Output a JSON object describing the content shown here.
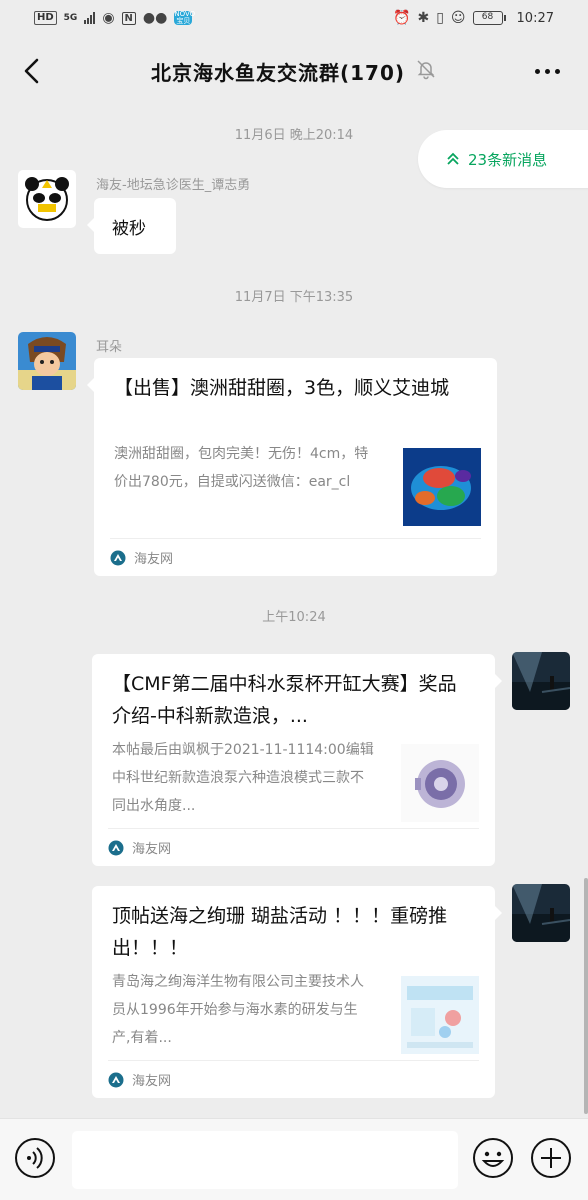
{
  "status_bar": {
    "hd": "HD",
    "network": "5G",
    "nfc": "N",
    "app_badge": "NOVO 宝贝",
    "battery": "68",
    "time": "10:27"
  },
  "header": {
    "title": "北京海水鱼友交流群(170)"
  },
  "new_messages": {
    "label": "23条新消息"
  },
  "messages": [
    {
      "timestamp": "11月6日 晚上20:14",
      "sender": "海友-地坛急诊医生_谭志勇",
      "text": "被秒"
    },
    {
      "timestamp": "11月7日 下午13:35",
      "sender": "耳朵",
      "card": {
        "title": "【出售】澳洲甜甜圈，3色，顺义艾迪城",
        "desc": "澳洲甜甜圈，包肉完美！无伤！4cm，特价出780元，自提或闪送微信：ear_cl",
        "source": "海友网"
      }
    },
    {
      "timestamp": "上午10:24",
      "card": {
        "title": "【CMF第二届中科水泵杯开缸大赛】奖品介绍-中科新款造浪，...",
        "desc": "本帖最后由飒枫于2021-11-1114:00编辑中科世纪新款造浪泵六种造浪模式三款不同出水角度...",
        "source": "海友网"
      }
    },
    {
      "card": {
        "title": "顶帖送海之绚珊 瑚盐活动 ！！！重磅推出！！！",
        "desc": "青岛海之绚海洋生物有限公司主要技术人员从1996年开始参与海水素的研发与生产,有着...",
        "source": "海友网"
      }
    }
  ],
  "input": {
    "placeholder": ""
  },
  "colors": {
    "background": "#ededed",
    "accent_green": "#07a55e",
    "card_background": "#ffffff"
  },
  "icons": [
    "back-arrow-icon",
    "mute-bell-icon",
    "more-icon",
    "double-chevron-up-icon",
    "source-logo-icon",
    "voice-icon",
    "emoji-icon",
    "plus-icon"
  ]
}
